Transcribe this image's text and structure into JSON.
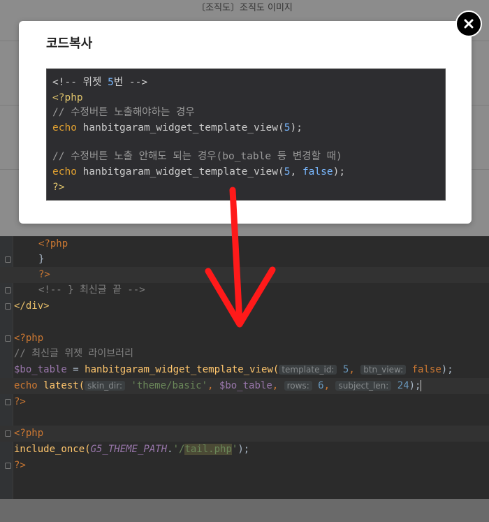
{
  "background": {
    "title": "〔조직도〕조직도 이미지"
  },
  "modal": {
    "title": "코드복사",
    "close_icon": "close-icon",
    "code": {
      "line1": {
        "open": "<!-- ",
        "label": "위젯 ",
        "num": "5",
        "suffix": "번 -->"
      },
      "line2": "<?php",
      "line3": "// 수정버튼 노출해야하는 경우",
      "line4": {
        "kw": "echo",
        "fn": " hanbitgaram_widget_template_view(",
        "num": "5",
        "end": ");"
      },
      "line5": "// 수정버튼 노출 안해도 되는 경우(bo_table 등 변경할 때)",
      "line6": {
        "kw": "echo",
        "fn": " hanbitgaram_widget_template_view(",
        "num": "5",
        "sep": ", ",
        "bool": "false",
        "end": ");"
      },
      "line7": "?>"
    }
  },
  "editor": {
    "l1": "<?php",
    "l2": "}",
    "l3": "?>",
    "l4": "<!-- } 최신글 끝 -->",
    "l5": "</div>",
    "l6": "<?php",
    "l7": "// 최신글 위젯 라이브러리",
    "l8": {
      "var": "$bo_table",
      "eq": " = ",
      "fn": "hanbitgaram_widget_template_view(",
      "hint1": "template_id:",
      "n1": "5",
      "comma": ", ",
      "hint2": "btn_view:",
      "b": "false",
      "end": ");"
    },
    "l9": {
      "kw": "echo",
      "fn": " latest(",
      "hint1": "skin_dir:",
      "s": "'theme/basic'",
      "comma1": ", ",
      "var": "$bo_table",
      "comma2": ", ",
      "hint2": "rows:",
      "n1": "6",
      "comma3": ", ",
      "hint3": "subject_len:",
      "n2": "24",
      "end": ");"
    },
    "l10": "?>",
    "l11": "<?php",
    "l12": {
      "fn": "include_once(",
      "const": "G5_THEME_PATH",
      "dot": ".",
      "s1": "'/",
      "hl": "tail.php",
      "s2": "'",
      "end": ");"
    },
    "l13": "?>"
  },
  "annotation": {
    "arrow_icon": "red-arrow-icon",
    "color": "#ff1a1a"
  }
}
